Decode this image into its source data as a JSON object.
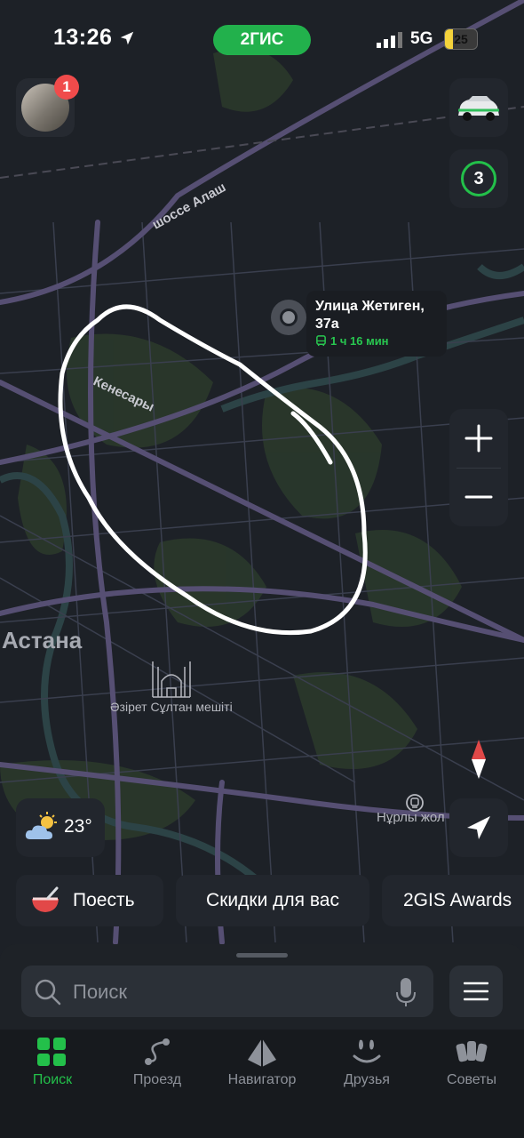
{
  "status_bar": {
    "time": "13:26",
    "app_label": "2ГИС",
    "network": "5G",
    "battery": "25",
    "battery_level": 0.25
  },
  "profile": {
    "notification_count": "1"
  },
  "traffic": {
    "level": "3",
    "color": "#23c04a"
  },
  "route_card": {
    "destination": "Улица Жетиген, 37а",
    "duration": "1 ч 16 мин",
    "transport_icon": "bus-icon"
  },
  "map_labels": {
    "road_alash": "шоссе Алаш",
    "street_kenesary": "Кенесары",
    "city": "Астана",
    "mosque": "Әзірет Сұлтан мешіті",
    "station": "Нұрлы жол"
  },
  "weather": {
    "temperature": "23°",
    "icon": "partly-cloudy-icon"
  },
  "chips": [
    {
      "label": "Поесть",
      "icon": "soup-bowl-icon"
    },
    {
      "label": "Скидки для вас"
    },
    {
      "label": "2GIS Awards"
    }
  ],
  "search": {
    "placeholder": "Поиск"
  },
  "tabs": [
    {
      "label": "Поиск",
      "icon": "grid-icon",
      "active": true
    },
    {
      "label": "Проезд",
      "icon": "route-icon"
    },
    {
      "label": "Навигатор",
      "icon": "navigator-icon"
    },
    {
      "label": "Друзья",
      "icon": "friends-icon"
    },
    {
      "label": "Советы",
      "icon": "cards-icon"
    }
  ],
  "colors": {
    "accent": "#23c04a",
    "badge": "#f04b4b",
    "map_bg": "#1d2127",
    "road": "#5a5276"
  }
}
